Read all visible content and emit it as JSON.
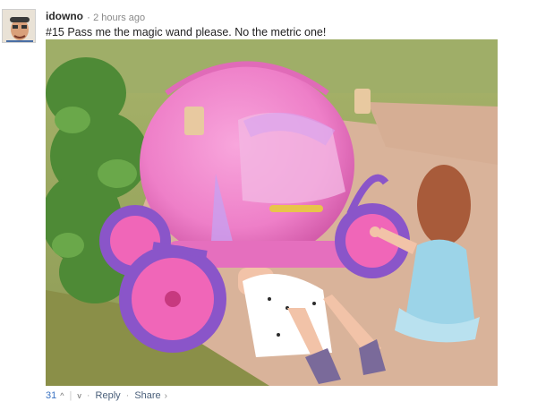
{
  "comment": {
    "username": "idowno",
    "timestamp": "2 hours ago",
    "separator": "·",
    "text": "#15 Pass me the magic wand please. No the metric one!"
  },
  "photo": {
    "scene": "girl-lying-under-pink-princess-carriage-while-another-girl-holds-wheel"
  },
  "footer": {
    "vote_count": "31",
    "upvote_icon": "^",
    "downvote_icon": "v",
    "reply_label": "Reply",
    "share_label": "Share",
    "dot": "·",
    "share_chevron": "›"
  },
  "colors": {
    "link_blue": "#3b73c2",
    "carriage_pink": "#ee7fc8",
    "wheel_purple": "#8a55c9"
  }
}
